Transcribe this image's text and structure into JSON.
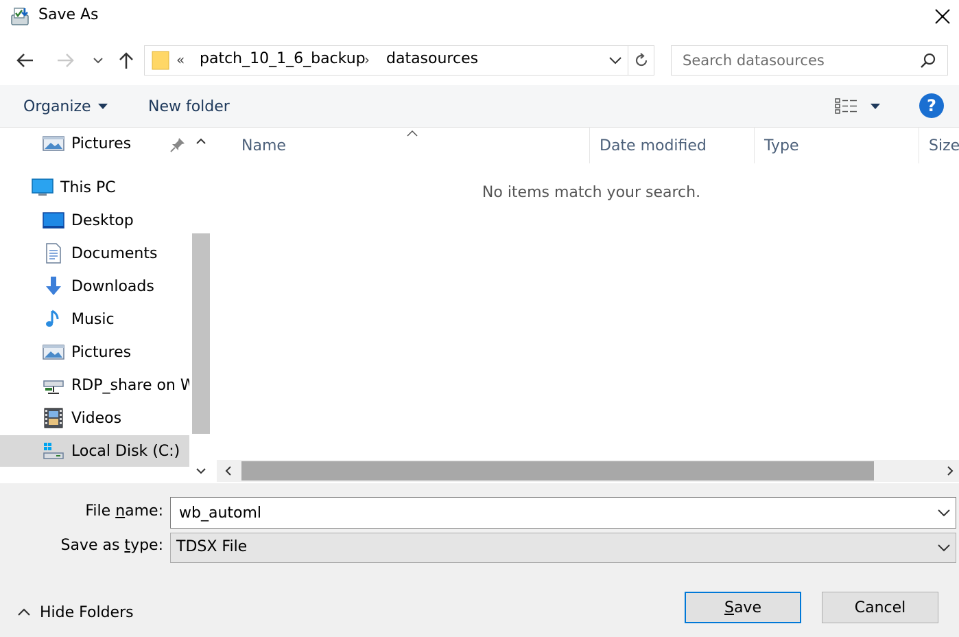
{
  "window": {
    "title": "Save As"
  },
  "address": {
    "overflow_glyph": "«",
    "crumbs": [
      "patch_10_1_6_backup",
      "datasources"
    ],
    "separator": "›"
  },
  "search": {
    "placeholder": "Search datasources"
  },
  "toolbar": {
    "organize_label": "Organize",
    "new_folder_label": "New folder",
    "help_glyph": "?"
  },
  "nav_pane": {
    "items": [
      {
        "label": "Pictures",
        "icon": "pictures-icon",
        "pinned": true
      },
      {
        "label": "This PC",
        "icon": "this-pc-icon"
      },
      {
        "label": "Desktop",
        "icon": "desktop-icon"
      },
      {
        "label": "Documents",
        "icon": "documents-icon"
      },
      {
        "label": "Downloads",
        "icon": "downloads-icon"
      },
      {
        "label": "Music",
        "icon": "music-icon"
      },
      {
        "label": "Pictures",
        "icon": "pictures-icon"
      },
      {
        "label": "RDP_share on W",
        "icon": "network-drive-icon"
      },
      {
        "label": "Videos",
        "icon": "videos-icon"
      },
      {
        "label": "Local Disk (C:)",
        "icon": "local-disk-icon",
        "selected": true
      }
    ]
  },
  "file_list": {
    "columns": [
      "Name",
      "Date modified",
      "Type",
      "Size"
    ],
    "empty_message": "No items match your search."
  },
  "form": {
    "file_name_label_pre": "File ",
    "file_name_label_u": "n",
    "file_name_label_post": "ame:",
    "file_name_value": "wb_automl",
    "save_type_label_pre": "Save as ",
    "save_type_label_u": "t",
    "save_type_label_post": "ype:",
    "save_type_value": "TDSX File"
  },
  "footer": {
    "hide_folders_label": "Hide Folders",
    "save_label_u": "S",
    "save_label_rest": "ave",
    "cancel_label": "Cancel"
  },
  "colors": {
    "accent": "#0078d7",
    "toolbar_text": "#1e395b",
    "help_blue": "#1a6fd1",
    "selected_bg": "#d9d9d9"
  }
}
